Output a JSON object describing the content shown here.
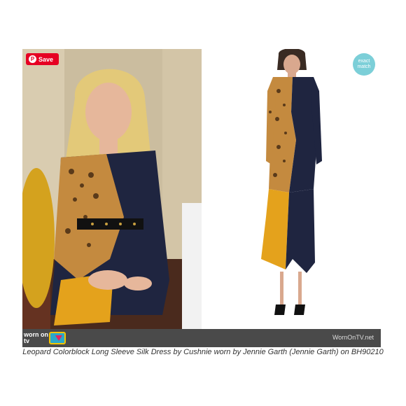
{
  "pin": {
    "save_label": "Save"
  },
  "badge": {
    "exact_match": "exact match"
  },
  "logo": {
    "text": "worn on tv"
  },
  "footer": {
    "watermark": "WornOnTV.net"
  },
  "caption": {
    "text": "Leopard Colorblock Long Sleeve Silk Dress by Cushnie worn by Jennie Garth (Jennie Garth) on BH90210"
  },
  "colors": {
    "pin_red": "#e60023",
    "badge_teal": "#7ccfd8",
    "footer_gray": "#4a4a4a",
    "mustard": "#e4a21c",
    "navy": "#1f2540"
  }
}
